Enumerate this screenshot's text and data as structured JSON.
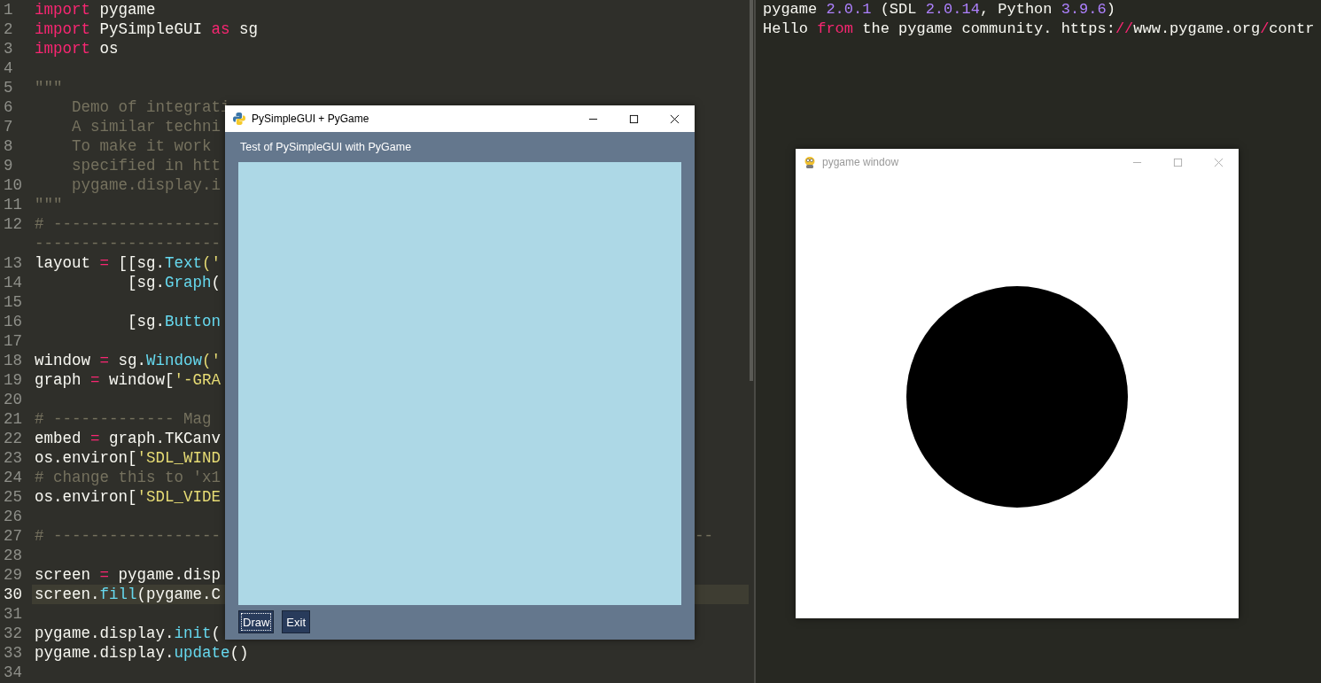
{
  "editor": {
    "lines": [
      {
        "number": "1",
        "current": false,
        "tokens": [
          {
            "text": "import",
            "kind": "keyword"
          },
          {
            "text": " pygame",
            "kind": "plain"
          }
        ]
      },
      {
        "number": "2",
        "current": false,
        "tokens": [
          {
            "text": "import",
            "kind": "keyword"
          },
          {
            "text": " PySimpleGUI ",
            "kind": "plain"
          },
          {
            "text": "as",
            "kind": "keyword"
          },
          {
            "text": " sg",
            "kind": "plain"
          }
        ]
      },
      {
        "number": "3",
        "current": false,
        "tokens": [
          {
            "text": "import",
            "kind": "keyword"
          },
          {
            "text": " os",
            "kind": "plain"
          }
        ]
      },
      {
        "number": "4",
        "current": false
      },
      {
        "number": "5",
        "current": false,
        "tokens": [
          {
            "text": "\"\"\"",
            "kind": "comment"
          }
        ]
      },
      {
        "number": "6",
        "current": false,
        "tokens": [
          {
            "text": "    Demo of integrati",
            "kind": "comment"
          }
        ]
      },
      {
        "number": "7",
        "current": false,
        "tokens": [
          {
            "text": "    A similar techni",
            "kind": "comment"
          }
        ]
      },
      {
        "number": "8",
        "current": false,
        "tokens": [
          {
            "text": "    To make it work",
            "kind": "comment"
          }
        ]
      },
      {
        "number": "9",
        "current": false,
        "tokens": [
          {
            "text": "    specified in htt",
            "kind": "comment"
          }
        ]
      },
      {
        "number": "10",
        "current": false,
        "tokens": [
          {
            "text": "    pygame.display.i",
            "kind": "comment"
          }
        ]
      },
      {
        "number": "11",
        "current": false,
        "tokens": [
          {
            "text": "\"\"\"",
            "kind": "comment"
          }
        ]
      },
      {
        "number": "12",
        "current": false,
        "tokens": [
          {
            "text": "# ------------------",
            "kind": "comment"
          }
        ]
      },
      {
        "tokens": [
          {
            "text": "--------------------",
            "kind": "comment"
          }
        ]
      },
      {
        "number": "13",
        "current": false,
        "tokens": [
          {
            "text": "layout ",
            "kind": "plain"
          },
          {
            "text": "=",
            "kind": "keyword"
          },
          {
            "text": " [[sg.",
            "kind": "plain"
          },
          {
            "text": "Text",
            "kind": "function"
          },
          {
            "text": "('",
            "kind": "string"
          }
        ]
      },
      {
        "number": "14",
        "current": false,
        "tokens": [
          {
            "text": "          [sg.",
            "kind": "plain"
          },
          {
            "text": "Graph",
            "kind": "function"
          },
          {
            "text": "(",
            "kind": "plain"
          }
        ]
      },
      {
        "number": "15",
        "current": false
      },
      {
        "number": "16",
        "current": false,
        "tokens": [
          {
            "text": "          [sg.",
            "kind": "plain"
          },
          {
            "text": "Button",
            "kind": "function"
          }
        ]
      },
      {
        "number": "17",
        "current": false
      },
      {
        "number": "18",
        "current": false,
        "tokens": [
          {
            "text": "window ",
            "kind": "plain"
          },
          {
            "text": "=",
            "kind": "keyword"
          },
          {
            "text": " sg.",
            "kind": "plain"
          },
          {
            "text": "Window",
            "kind": "function"
          },
          {
            "text": "('",
            "kind": "string"
          }
        ]
      },
      {
        "number": "19",
        "current": false,
        "tokens": [
          {
            "text": "graph ",
            "kind": "plain"
          },
          {
            "text": "=",
            "kind": "keyword"
          },
          {
            "text": " window[",
            "kind": "plain"
          },
          {
            "text": "'-GRA",
            "kind": "string"
          }
        ]
      },
      {
        "number": "20",
        "current": false
      },
      {
        "number": "21",
        "current": false,
        "tokens": [
          {
            "text": "# ------------- Mag",
            "kind": "comment"
          }
        ]
      },
      {
        "number": "22",
        "current": false,
        "tokens": [
          {
            "text": "embed ",
            "kind": "plain"
          },
          {
            "text": "=",
            "kind": "keyword"
          },
          {
            "text": " graph.TKCanv",
            "kind": "plain"
          }
        ]
      },
      {
        "number": "23",
        "current": false,
        "tokens": [
          {
            "text": "os.environ[",
            "kind": "plain"
          },
          {
            "text": "'SDL_WIND",
            "kind": "string"
          }
        ]
      },
      {
        "number": "24",
        "current": false,
        "tokens": [
          {
            "text": "# change this to 'x1",
            "kind": "comment"
          }
        ]
      },
      {
        "number": "25",
        "current": false,
        "tokens": [
          {
            "text": "os.environ[",
            "kind": "plain"
          },
          {
            "text": "'SDL_VIDE",
            "kind": "string"
          }
        ]
      },
      {
        "number": "26",
        "current": false
      },
      {
        "number": "27",
        "current": false,
        "tokens": [
          {
            "text": "# ------------------",
            "kind": "comment"
          }
        ],
        "tail": [
          {
            "text": "--",
            "kind": "comment"
          }
        ]
      },
      {
        "number": "28",
        "current": false
      },
      {
        "number": "29",
        "current": false,
        "tokens": [
          {
            "text": "screen ",
            "kind": "plain"
          },
          {
            "text": "=",
            "kind": "keyword"
          },
          {
            "text": " pygame.disp",
            "kind": "plain"
          }
        ]
      },
      {
        "number": "30",
        "current": true,
        "tokens": [
          {
            "text": "screen.",
            "kind": "plain"
          },
          {
            "text": "fill",
            "kind": "function"
          },
          {
            "text": "(pygame.C",
            "kind": "plain"
          }
        ]
      },
      {
        "number": "31",
        "current": false
      },
      {
        "number": "32",
        "current": false,
        "tokens": [
          {
            "text": "pygame.display.",
            "kind": "plain"
          },
          {
            "text": "init",
            "kind": "function"
          },
          {
            "text": "(",
            "kind": "plain"
          }
        ]
      },
      {
        "number": "33",
        "current": false,
        "tokens": [
          {
            "text": "pygame.display.",
            "kind": "plain"
          },
          {
            "text": "update",
            "kind": "function"
          },
          {
            "text": "()",
            "kind": "plain"
          }
        ]
      },
      {
        "number": "34",
        "current": false
      }
    ]
  },
  "console": {
    "lines": [
      {
        "tokens": [
          {
            "text": "pygame ",
            "kind": "plain"
          },
          {
            "text": "2.0.1",
            "kind": "number"
          },
          {
            "text": " (SDL ",
            "kind": "plain"
          },
          {
            "text": "2.0.14",
            "kind": "number"
          },
          {
            "text": ", Python ",
            "kind": "plain"
          },
          {
            "text": "3.9.6",
            "kind": "number"
          },
          {
            "text": ")",
            "kind": "plain"
          }
        ]
      },
      {
        "tokens": [
          {
            "text": "Hello ",
            "kind": "plain"
          },
          {
            "text": "from",
            "kind": "keyword"
          },
          {
            "text": " the pygame community. https:",
            "kind": "plain"
          },
          {
            "text": "//",
            "kind": "keyword"
          },
          {
            "text": "www.pygame.org",
            "kind": "plain"
          },
          {
            "text": "/",
            "kind": "keyword"
          },
          {
            "text": "contr",
            "kind": "plain"
          }
        ]
      }
    ]
  },
  "gui_window": {
    "title": "PySimpleGUI + PyGame",
    "active": true,
    "label": "Test of PySimpleGUI with PyGame",
    "buttons": [
      {
        "label": "Draw",
        "focused": true
      },
      {
        "label": "Exit",
        "focused": false
      }
    ]
  },
  "pygame_window": {
    "title": "pygame window",
    "active": false
  }
}
